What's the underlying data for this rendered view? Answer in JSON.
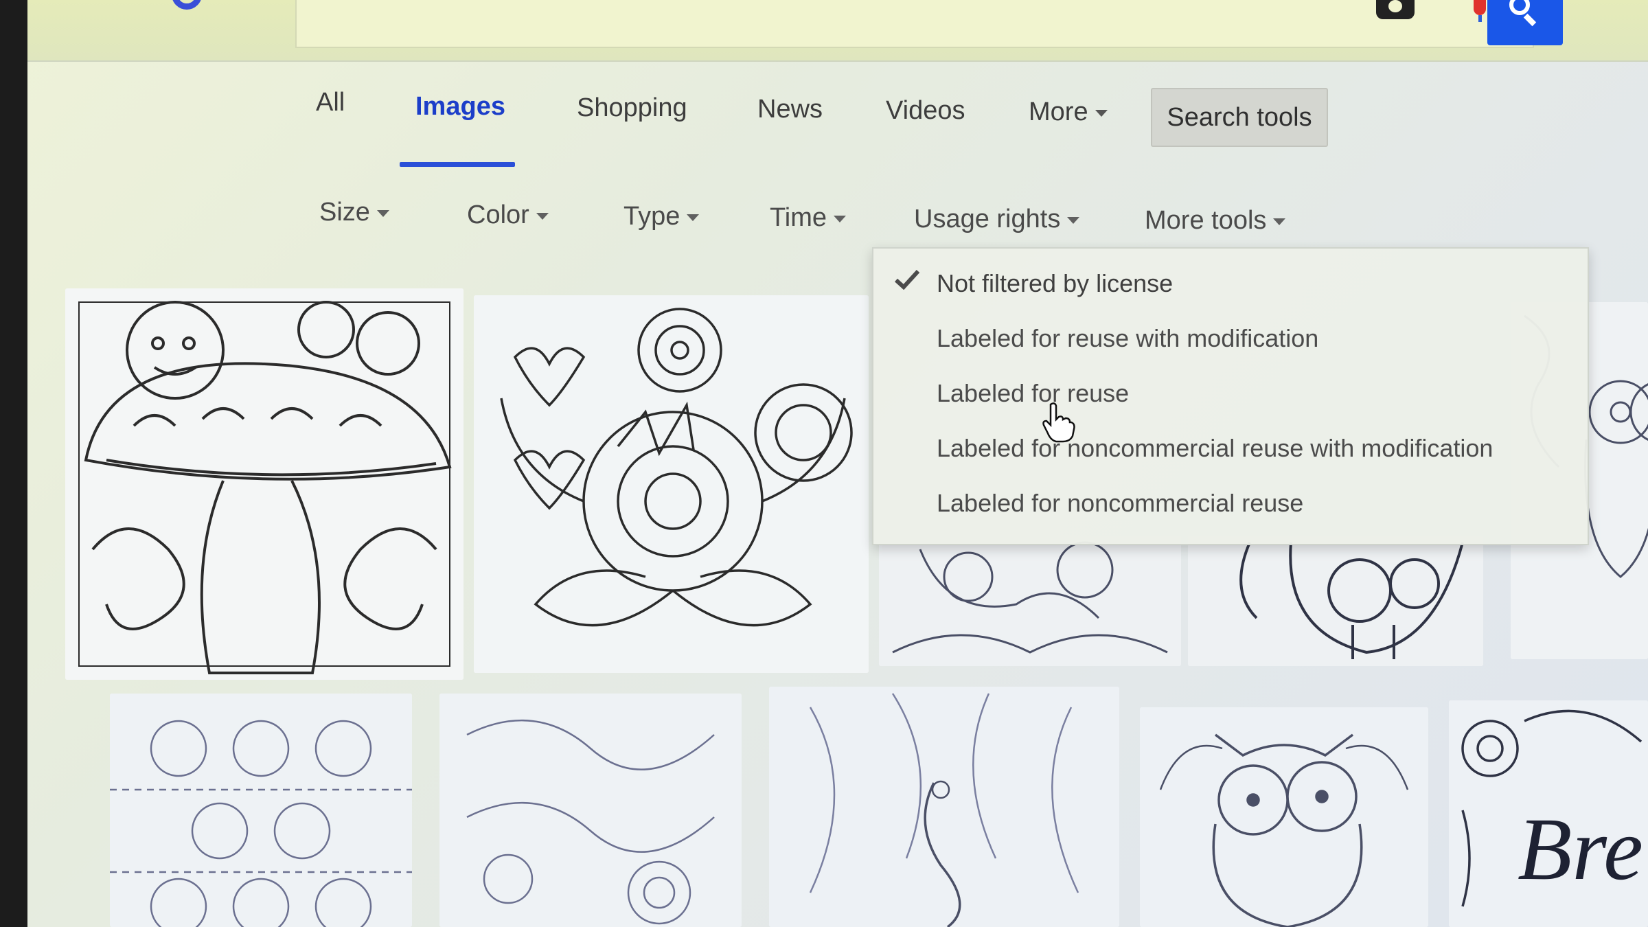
{
  "tabs": {
    "all": "All",
    "images": "Images",
    "shopping": "Shopping",
    "news": "News",
    "videos": "Videos",
    "more": "More",
    "search_tools": "Search tools"
  },
  "tools": {
    "size": "Size",
    "color": "Color",
    "type": "Type",
    "time": "Time",
    "usage_rights": "Usage rights",
    "more_tools": "More tools"
  },
  "usage_rights_menu": {
    "selected_index": 0,
    "items": [
      "Not filtered by license",
      "Labeled for reuse with modification",
      "Labeled for reuse",
      "Labeled for noncommercial reuse with modification",
      "Labeled for noncommercial reuse"
    ]
  },
  "image_results": {
    "last_visible_caption_fragment": "Bre"
  },
  "colors": {
    "accent": "#1c3ec9",
    "search_button": "#1a57e8",
    "background": "#e6ecdf"
  },
  "icons": {
    "check": "check-icon",
    "camera": "camera-icon",
    "mic": "mic-icon",
    "search": "search-icon",
    "cursor": "hand-pointer-icon"
  }
}
